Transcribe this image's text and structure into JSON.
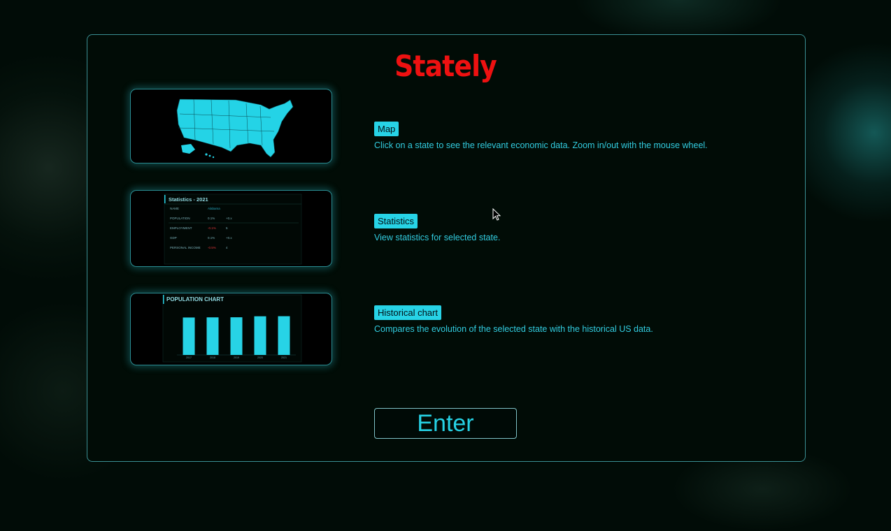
{
  "app": {
    "title": "Stately"
  },
  "features": [
    {
      "label": "Map",
      "description": "Click on a state to see the relevant economic data. Zoom in/out with the mouse wheel."
    },
    {
      "label": "Statistics",
      "description": "View statistics for selected state."
    },
    {
      "label": "Historical chart",
      "description": "Compares the evolution of the selected state with the historical US data."
    }
  ],
  "previews": {
    "statistics": {
      "title": "Statistics - 2021",
      "rows": [
        {
          "name": "NAME",
          "value": "Alabama",
          "extra": ""
        },
        {
          "name": "POPULATION",
          "value": "0.1%",
          "extra": "+0.x"
        },
        {
          "name": "EMPLOYMENT",
          "value": "-0.1%",
          "extra": "5"
        },
        {
          "name": "GDP",
          "value": "0.1%",
          "extra": "+0.x"
        },
        {
          "name": "PERSONAL INCOME",
          "value": "-0.5%",
          "extra": "4"
        }
      ]
    },
    "chart": {
      "title": "POPULATION CHART",
      "chart_data": {
        "type": "bar",
        "categories": [
          "2017",
          "2018",
          "2019",
          "2020",
          "2021"
        ],
        "values": [
          4.87,
          4.89,
          4.9,
          5.03,
          5.04
        ],
        "ylim": [
          0,
          6
        ]
      }
    }
  },
  "enter_label": "Enter",
  "colors": {
    "accent": "#27d3e6",
    "title": "#ee1111",
    "border": "#3a8f93"
  }
}
